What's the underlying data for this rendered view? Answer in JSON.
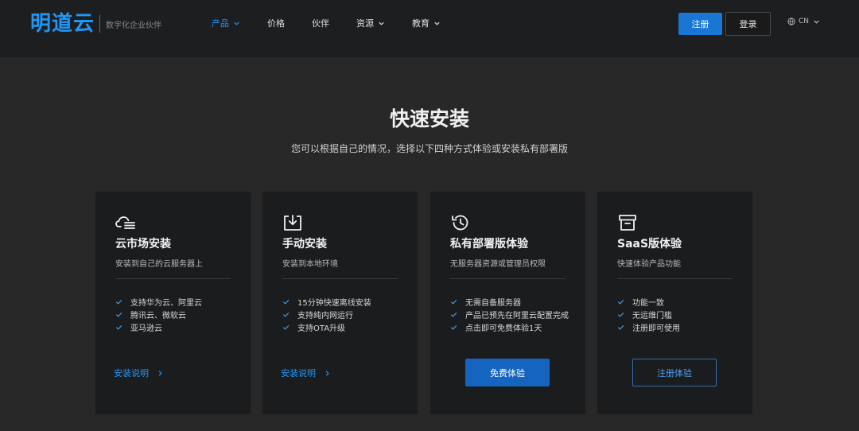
{
  "header": {
    "logo": "明道云",
    "slogan": "数字化企业伙伴",
    "nav": [
      {
        "label": "产品",
        "has_dropdown": true,
        "active": true
      },
      {
        "label": "价格",
        "has_dropdown": false,
        "active": false
      },
      {
        "label": "伙伴",
        "has_dropdown": false,
        "active": false
      },
      {
        "label": "资源",
        "has_dropdown": true,
        "active": false
      },
      {
        "label": "教育",
        "has_dropdown": true,
        "active": false
      }
    ],
    "register_label": "注册",
    "login_label": "登录",
    "lang_label": "CN",
    "accent_color": "#2196f3"
  },
  "hero": {
    "title": "快速安装",
    "subtitle": "您可以根据自己的情况，选择以下四种方式体验或安装私有部署版"
  },
  "cards": [
    {
      "icon": "cloud-list-icon",
      "title": "云市场安装",
      "desc": "安装到自己的云服务器上",
      "features": [
        "支持华为云、阿里云",
        "腾讯云、微软云",
        "亚马逊云"
      ],
      "action": "安装说明"
    },
    {
      "icon": "download-box-icon",
      "title": "手动安装",
      "desc": "安装到本地环境",
      "features": [
        "15分钟快速离线安装",
        "支持纯内网运行",
        "支持OTA升级"
      ],
      "action": "安装说明"
    },
    {
      "icon": "history-clock-icon",
      "title": "私有部署版体验",
      "desc": "无服务器资源或管理员权限",
      "features": [
        "无需自备服务器",
        "产品已预先在阿里云配置完成",
        "点击即可免费体验1天"
      ],
      "action": "免费体验"
    },
    {
      "icon": "archive-box-icon",
      "title": "SaaS版体验",
      "desc": "快速体验产品功能",
      "features": [
        "功能一致",
        "无运维门槛",
        "注册即可使用"
      ],
      "action": "注册体验"
    }
  ]
}
